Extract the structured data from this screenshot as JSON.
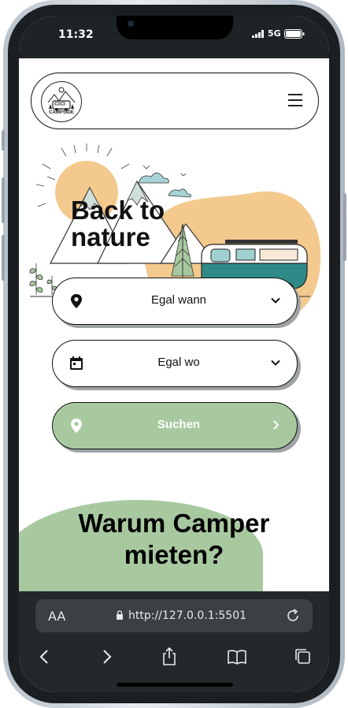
{
  "status": {
    "time": "11:32",
    "network": "5G"
  },
  "navbar": {
    "logo_text": "CAMPSIDE"
  },
  "hero": {
    "title": "Back to nature"
  },
  "search": {
    "when_label": "Egal wann",
    "where_label": "Egal wo",
    "submit_label": "Suchen"
  },
  "section": {
    "title": "Warum Camper mieten?"
  },
  "browser": {
    "text_size_label": "AA",
    "url": "http://127.0.0.1:5501"
  },
  "colors": {
    "accent_green": "#a8c9a0",
    "sun": "#f3c98e",
    "van_teal": "#2f8a87"
  }
}
